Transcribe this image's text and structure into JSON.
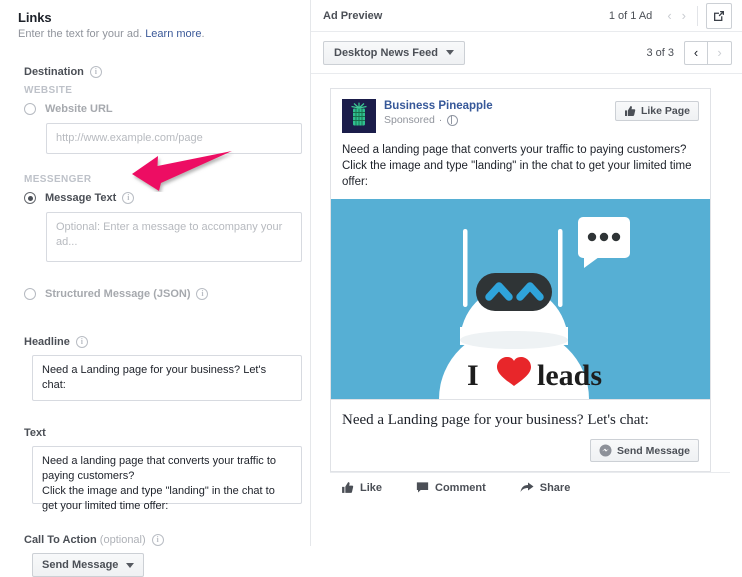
{
  "left_panel": {
    "title": "Links",
    "subtitle_text": "Enter the text for your ad.",
    "subtitle_link": "Learn more",
    "subtitle_period": ".",
    "destination_label": "Destination",
    "website_group": "WEBSITE",
    "website_url_option": "Website URL",
    "website_url_placeholder": "http://www.example.com/page",
    "messenger_group": "MESSENGER",
    "message_text_option": "Message Text",
    "message_text_placeholder": "Optional: Enter a message to accompany your ad...",
    "structured_option": "Structured Message (JSON)",
    "headline_label": "Headline",
    "headline_value": "Need a Landing page for your business? Let's chat:",
    "text_label": "Text",
    "text_value": "Need a landing page that converts your traffic to paying customers?\nClick the image and type \"landing\" in the chat to get your limited time offer:",
    "cta_label": "Call To Action",
    "cta_optional": "(optional)",
    "cta_value": "Send Message",
    "info_glyph": "i",
    "annotation_arrow_color": "#ED1164"
  },
  "preview": {
    "title": "Ad Preview",
    "ad_count": "1 of 1 Ad",
    "prev_glyph": "‹",
    "next_glyph": "›",
    "expand_icon": "external-link-icon",
    "placement_select": "Desktop News Feed",
    "variation_count": "3 of 3",
    "nav_prev": "‹",
    "nav_next": "›"
  },
  "ad": {
    "page_name": "Business Pineapple",
    "sponsored": "Sponsored",
    "like_page": "Like Page",
    "body_line1": "Need a landing page that converts your traffic to paying customers?",
    "body_line2": "Click the image and type \"landing\" in the chat to get your limited time offer:",
    "image": {
      "background": "#56AFD4",
      "robot_color": "#FFFFFF",
      "visor_color": "#2F3436",
      "eye_color": "#2FA4DB",
      "caption_i": "I",
      "caption_word": "leads",
      "heart_color": "#E8262A",
      "bubble_dots": 3
    },
    "headline": "Need a Landing page for your business? Let's chat:",
    "send_message": "Send Message",
    "actions": [
      {
        "label": "Like",
        "icon": "thumbs-up-icon"
      },
      {
        "label": "Comment",
        "icon": "comment-icon"
      },
      {
        "label": "Share",
        "icon": "share-arrow-icon"
      }
    ]
  }
}
